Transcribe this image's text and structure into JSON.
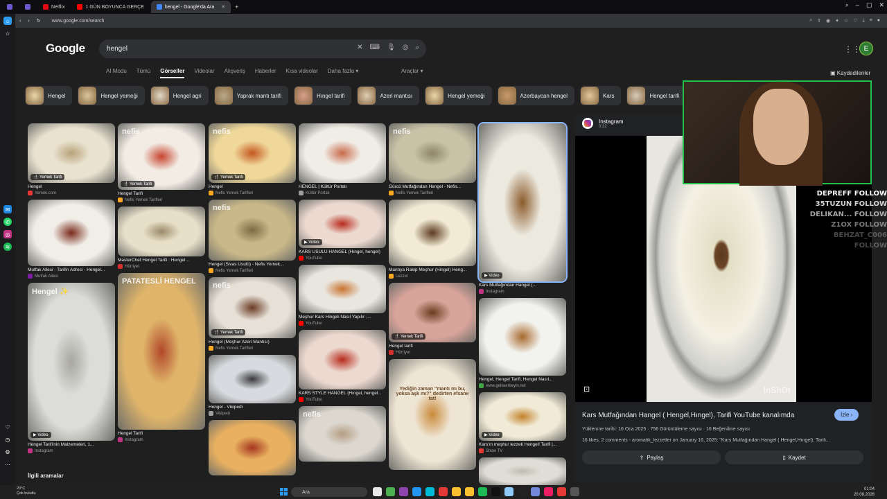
{
  "browser": {
    "tabs": [
      {
        "label": "",
        "color": "#6a5acd"
      },
      {
        "label": "",
        "color": "#6a5acd"
      },
      {
        "label": "Netflix",
        "color": "#e50914"
      },
      {
        "label": "1 GÜN BOYUNCA GERÇE",
        "color": "#ff0000"
      },
      {
        "label": "hengel - Google'da Ara",
        "color": "#4285f4",
        "active": true
      }
    ],
    "new_tab": "+",
    "url": "www.google.com/search"
  },
  "google": {
    "logo": "Google",
    "query": "hengel",
    "avatar_letter": "E",
    "nav": [
      "AI Modu",
      "Tümü",
      "Görseller",
      "Videolar",
      "Alışveriş",
      "Haberler",
      "Kısa videolar",
      "Daha fazla ▾"
    ],
    "nav_active": "Görseller",
    "tools": "Araçlar ▾",
    "saved": "Kaydedilenler",
    "chips": [
      "Hengel",
      "Hengel yemeği",
      "Hengel agri",
      "Yaprak mantı tarifi",
      "Hıngel tarifi",
      "Azeri mantısı",
      "Hengel yemeği",
      "Azerbaycan hengel",
      "Kars",
      "Hengel tarifi"
    ],
    "related": "İlgili aramalar"
  },
  "grid": {
    "columns": [
      [
        {
          "title": "Hengel",
          "source": "Yemek.com",
          "badge": "🍴 Yemek Tarifi",
          "h": 86,
          "c1": "#e9e2cf",
          "c2": "#b8a27a",
          "sc": "#e53935"
        },
        {
          "title": "Mutfak Ailesi - Tarifin Adresi - Hengel...",
          "source": "Mutfak Ailesi",
          "badge": "",
          "h": 96,
          "c1": "#f1eee8",
          "c2": "#7a2b1c",
          "sc": "#7b1fa2"
        },
        {
          "title": "Hengel Tarifi'nin Malzemeleri, 1...",
          "source": "Instagram",
          "badge": "▶ Video",
          "h": 228,
          "c1": "#dcdcd8",
          "c2": "#a7a6a0",
          "sc": "#c13584",
          "wm": "Hengel ✨"
        }
      ],
      [
        {
          "title": "Hengel Tarifi",
          "source": "Nefis Yemek Tarifleri",
          "badge": "🍴 Yemek Tarifi",
          "h": 96,
          "c1": "#f2ece4",
          "c2": "#c7442f",
          "sc": "#f9a825",
          "wm": "nefis"
        },
        {
          "title": "MasterChef Hengel Tarifi : Hengel...",
          "source": "Hürriyet",
          "badge": "",
          "h": 72,
          "c1": "#e7dfc8",
          "c2": "#9a8a68",
          "sc": "#d32f2f"
        },
        {
          "title": "Hengel Tarifi",
          "source": "Instagram",
          "badge": "",
          "h": 226,
          "c1": "#e0b56a",
          "c2": "#b1472a",
          "sc": "#c13584",
          "wm": "PATATESLİ HENGEL"
        }
      ],
      [
        {
          "title": "Hengel",
          "source": "Nefis Yemek Tarifleri",
          "badge": "🍴 Yemek Tarifi",
          "h": 86,
          "c1": "#f0d89a",
          "c2": "#c4571f",
          "sc": "#f9a825",
          "wm": "nefis"
        },
        {
          "title": "Hengel (Sivas Usulü) - Nefis Yemek...",
          "source": "Nefis Yemek Tarifleri",
          "badge": "",
          "h": 88,
          "c1": "#c9b888",
          "c2": "#7c6a44",
          "sc": "#f9a825",
          "wm": "nefis"
        },
        {
          "title": "Hengel (Meşhur Azeri Mantısı)",
          "source": "Nefis Yemek Tarifleri",
          "badge": "🍴 Yemek Tarifi",
          "h": 88,
          "c1": "#e6e0d6",
          "c2": "#6a3a24",
          "sc": "#f9a825",
          "wm": "nefis"
        },
        {
          "title": "Hengel - Vikipedi",
          "source": "Vikipedi",
          "badge": "",
          "h": 70,
          "c1": "#d8dadf",
          "c2": "#3a3a3c",
          "sc": "#9e9e9e"
        },
        {
          "title": "",
          "source": "",
          "badge": "",
          "h": 80,
          "c1": "#e8b060",
          "c2": "#a5351f",
          "sc": "#999"
        }
      ],
      [
        {
          "title": "HENGEL | Kültür Portalı",
          "source": "Kültür Portalı",
          "badge": "",
          "h": 86,
          "c1": "#f0ece6",
          "c2": "#c86a4a",
          "sc": "#9e9e9e"
        },
        {
          "title": "KARS USULÜ HANGEL (Hıngel, hengel)",
          "source": "YouTube",
          "badge": "▶ Video",
          "h": 70,
          "c1": "#ecd9cf",
          "c2": "#b72a1c",
          "sc": "#ff0000"
        },
        {
          "title": "Meşhur Kars Hingeli Nasıl Yapılır -...",
          "source": "YouTube",
          "badge": "",
          "h": 70,
          "c1": "#e9e6df",
          "c2": "#c9722e",
          "sc": "#ff0000"
        },
        {
          "title": "KARS STYLE HANGEL (Hıngel, hengel...",
          "source": "YouTube",
          "badge": "",
          "h": 86,
          "c1": "#ecd9cf",
          "c2": "#b72a1c",
          "sc": "#ff0000"
        },
        {
          "title": "",
          "source": "",
          "badge": "",
          "h": 80,
          "c1": "#dcd8d0",
          "c2": "#b59e84",
          "sc": "#999",
          "wm": "nefis"
        }
      ],
      [
        {
          "title": "Gürcü Mutfağından Hengel - Nefis...",
          "source": "Nefis Yemek Tarifleri",
          "badge": "",
          "h": 86,
          "c1": "#c8c2a6",
          "c2": "#8d8566",
          "sc": "#f9a825",
          "wm": "nefis"
        },
        {
          "title": "Mantıya Rakip Meşhur (Hingel) Heng...",
          "source": "Lezzet",
          "badge": "",
          "h": 96,
          "c1": "#f2ead4",
          "c2": "#5c3a1f",
          "sc": "#f9a825"
        },
        {
          "title": "Hengel tarifi",
          "source": "Hürriyet",
          "badge": "🍴 Yemek Tarifi",
          "h": 86,
          "c1": "#d9a49a",
          "c2": "#6b3b1e",
          "sc": "#d32f2f"
        },
        {
          "title": "",
          "source": "",
          "badge": "",
          "h": 160,
          "c1": "#efe5d4",
          "c2": "#c98a3a",
          "sc": "#999",
          "wm": "Yediğin zaman \"mantı mı bu, yoksa aşk mı?\" dedirten efsane tat!"
        }
      ],
      [
        {
          "title": "Kars Mutfağından Hangel (...",
          "source": "Instagram",
          "badge": "▶ Video",
          "h": 228,
          "c1": "#ece9df",
          "c2": "#8a5a2a",
          "sc": "#c13584",
          "selected": true
        },
        {
          "title": "Hengel, Hengel Tarifi, Hengel Nasıl...",
          "source": "www.gelisenbeyin.net",
          "badge": "",
          "h": 112,
          "c1": "#f2f2ee",
          "c2": "#a86a2e",
          "sc": "#43a047"
        },
        {
          "title": "Kars'ın meşhur lezzeti Hengel! Tarifi |...",
          "source": "Show TV",
          "badge": "▶ Video",
          "h": 70,
          "c1": "#f0ead6",
          "c2": "#c4822a",
          "sc": "#e53935"
        },
        {
          "title": "",
          "source": "",
          "badge": "",
          "h": 40,
          "c1": "#e0ddd6",
          "c2": "#c0bcb2",
          "sc": "#999"
        }
      ]
    ]
  },
  "preview": {
    "source": "Instagram",
    "duration": "0:32",
    "watermark": "InShOt",
    "title": "Kars Mutfağından Hangel ( Hengel,Hıngel), Tarifi YouTube kanalımda",
    "visit": "İzle ›",
    "meta": "Yüklenme tarihi: 16 Oca 2025 · 756 Görüntüleme sayısı · 16 Beğenilme sayısı",
    "description": "16 likes, 2 comments - aromatik_lezzetler on January 16, 2025: \"Kars Mutfağından Hangel ( Hengel,Hıngel), Tarifi...",
    "share": "Paylaş",
    "save": "Kaydet"
  },
  "stream_overlay": {
    "follows": [
      "DEPREFF  FOLLOW",
      "35TUZUN  FOLLOW",
      "DELIKAN...  FOLLOW",
      "Z1OX  FOLLOW",
      "BEHZAT_C006  FOLLOW"
    ]
  },
  "taskbar": {
    "weather_temp": "20°C",
    "weather_desc": "Çok bulutlu",
    "search": "Ara",
    "time": "01:04",
    "date": "20.08.2026",
    "icon_colors": [
      "#e8e8e8",
      "#4caf50",
      "#8e44ad",
      "#2196f3",
      "#00bcd4",
      "#e53935",
      "#fbc02d",
      "#fbc02d",
      "#1db954",
      "#111111",
      "#90caf9",
      "#222222",
      "#7289da",
      "#e91e63",
      "#e53935",
      "#555555"
    ]
  }
}
